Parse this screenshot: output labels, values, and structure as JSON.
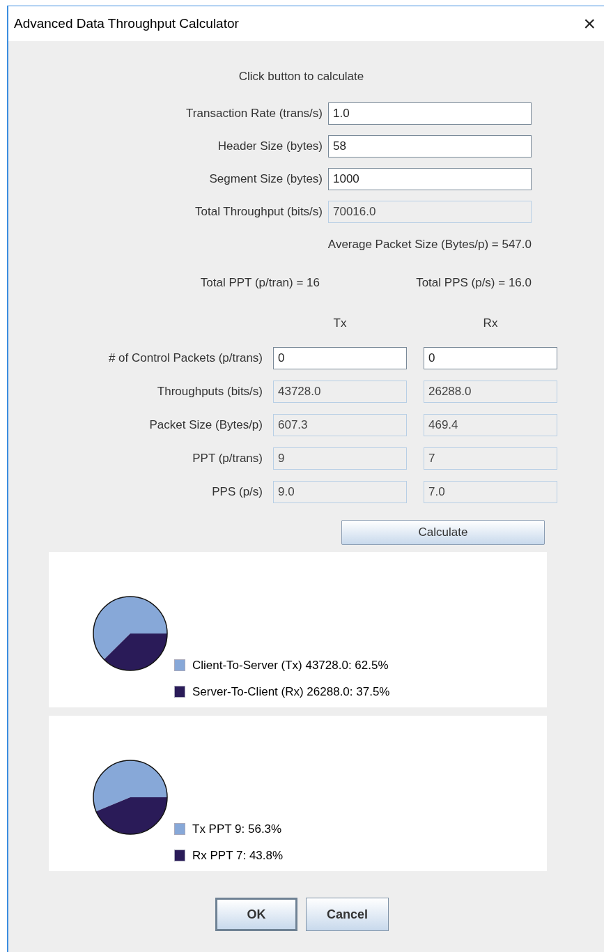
{
  "window": {
    "title": "Advanced Data Throughput Calculator",
    "close": "×"
  },
  "instruction": "Click button to calculate",
  "fields": [
    {
      "label": "Transaction Rate (trans/s)",
      "value": "1.0",
      "editable": true
    },
    {
      "label": "Header Size (bytes)",
      "value": "58",
      "editable": true
    },
    {
      "label": "Segment Size (bytes)",
      "value": "1000",
      "editable": true
    },
    {
      "label": "Total Throughput (bits/s)",
      "value": "70016.0",
      "editable": false
    }
  ],
  "average_packet_size": "Average Packet Size (Bytes/p) = 547.0",
  "total_ppt": "Total PPT (p/tran) = 16",
  "total_pps": "Total PPS (p/s) = 16.0",
  "columns": [
    "Tx",
    "Rx"
  ],
  "rows": [
    {
      "label": "# of Control Packets (p/trans)",
      "tx": "0",
      "rx": "0",
      "editable": true
    },
    {
      "label": "Throughputs (bits/s)",
      "tx": "43728.0",
      "rx": "26288.0",
      "editable": false
    },
    {
      "label": "Packet Size (Bytes/p)",
      "tx": "607.3",
      "rx": "469.4",
      "editable": false
    },
    {
      "label": "PPT (p/trans)",
      "tx": "9",
      "rx": "7",
      "editable": false
    },
    {
      "label": "PPS (p/s)",
      "tx": "9.0",
      "rx": "7.0",
      "editable": false
    }
  ],
  "calculate_button": "Calculate",
  "charts": [
    {
      "slices": [
        {
          "color": "#87a8d8"
        },
        {
          "color": "#2a1b58"
        }
      ],
      "chart_data": {
        "type": "pie",
        "legend": true,
        "categories": [
          "Client-To-Server (Tx) 43728.0: 62.5%",
          "Server-To-Client (Rx) 26288.0: 37.5%"
        ],
        "values": [
          43728.0,
          26288.0
        ]
      }
    },
    {
      "slices": [
        {
          "color": "#87a8d8"
        },
        {
          "color": "#2a1b58"
        }
      ],
      "chart_data": {
        "type": "pie",
        "legend": true,
        "categories": [
          "Tx PPT 9: 56.3%",
          "Rx PPT 7: 43.8%"
        ],
        "values": [
          9,
          7
        ]
      }
    }
  ],
  "buttons": [
    {
      "label": "OK",
      "default": true
    },
    {
      "label": "Cancel",
      "default": false
    }
  ]
}
